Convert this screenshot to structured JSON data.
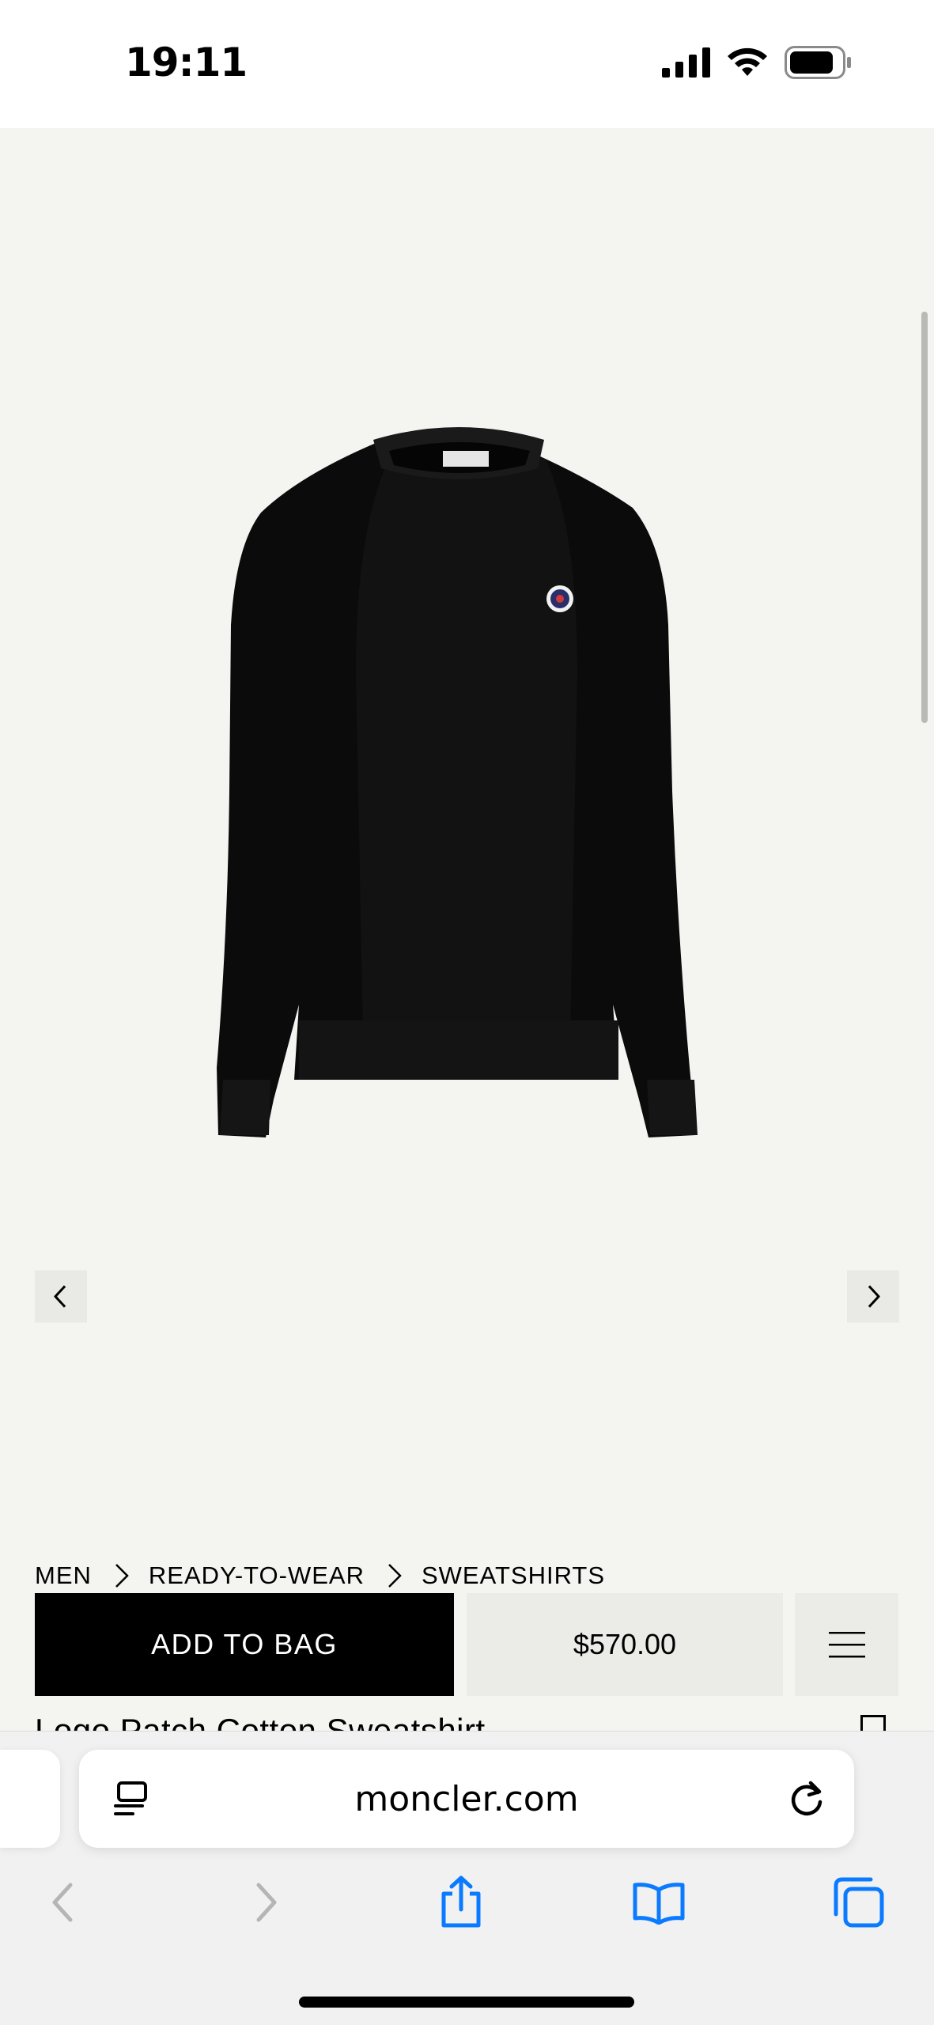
{
  "status_bar": {
    "time": "19:11"
  },
  "product": {
    "image_icon": "sweatshirt-image",
    "prev_icon": "chevron-left-icon",
    "next_icon": "chevron-right-icon"
  },
  "breadcrumb": [
    "MEN",
    "READY-TO-WEAR",
    "SWEATSHIRTS"
  ],
  "actions": {
    "add_to_bag": "ADD TO BAG",
    "price": "$570.00",
    "menu_icon": "hamburger-menu-icon"
  },
  "title": "Logo Patch Cotton Sweatshirt",
  "browser": {
    "url": "moncler.com",
    "toolbar": [
      "back-icon",
      "forward-icon",
      "share-icon",
      "bookmarks-icon",
      "tabs-icon"
    ]
  },
  "colors": {
    "background": "#f4f4f1",
    "primary_button": "#000000",
    "secondary_button": "#ebebe7",
    "safari_blue": "#0a7aff"
  }
}
